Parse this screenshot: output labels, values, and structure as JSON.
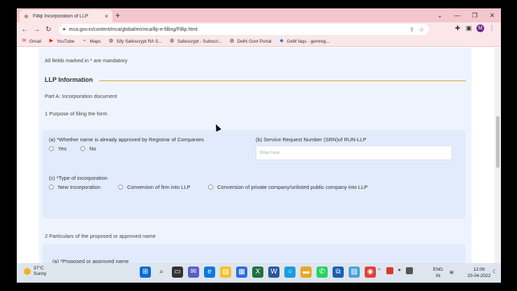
{
  "browser": {
    "tab_title": "Fillip Incorporation of LLP",
    "tab_close": "×",
    "new_tab": "+",
    "url": "mca.gov.in/content/mca/global/en/mca/llp-e-filling/Fillip.html",
    "profile_initial": "M",
    "bookmarks": [
      {
        "label": "Gmail",
        "icon": "gmail-icon",
        "color": "#d93025"
      },
      {
        "label": "YouTube",
        "icon": "youtube-icon",
        "color": "#ff0000"
      },
      {
        "label": "Maps",
        "icon": "maps-icon",
        "color": "#34a853"
      },
      {
        "label": "Sify Safescrypt RA S...",
        "icon": "globe-icon",
        "color": "#333333"
      },
      {
        "label": "Safescrypt - Subscri...",
        "icon": "globe-icon",
        "color": "#333333"
      },
      {
        "label": "Delhi Govt Portal",
        "icon": "globe-icon",
        "color": "#333333"
      },
      {
        "label": "GeM faqs - gemreg...",
        "icon": "gem-icon",
        "color": "#1a73e8"
      }
    ]
  },
  "form": {
    "mandatory_note": "All fields marked in * are mandatory",
    "section_title": "LLP Information",
    "part_a": "Part A: Incorporation document",
    "q1": "1 Purpose of filing the form",
    "field_a_label": "(a) *Whether name is already approved by Registrar of Companies",
    "field_a_options": [
      "Yes",
      "No"
    ],
    "field_b_label": "(b) Service Request Number (SRN)of RUN-LLP",
    "field_b_placeholder": "Enter here",
    "field_c_label": "(c) *Type of incorporation",
    "field_c_options": [
      "New Incorporation",
      "Conversion of firm into LLP",
      "Conversion of private company/unlisted public company into LLP"
    ],
    "q2": "2 Particulars of the proposed or approved name",
    "q2a_label": "(a) *Proposed or approved name"
  },
  "taskbar": {
    "temperature": "37°C",
    "weather": "Sunny",
    "lang_1": "ENG",
    "lang_2": "IN",
    "time": "12:09",
    "date": "20-04-2022"
  },
  "colors": {
    "accent_rule": "#d9a637",
    "card_bg": "#eef4fd",
    "tab_strip": "#f4c6cd"
  }
}
